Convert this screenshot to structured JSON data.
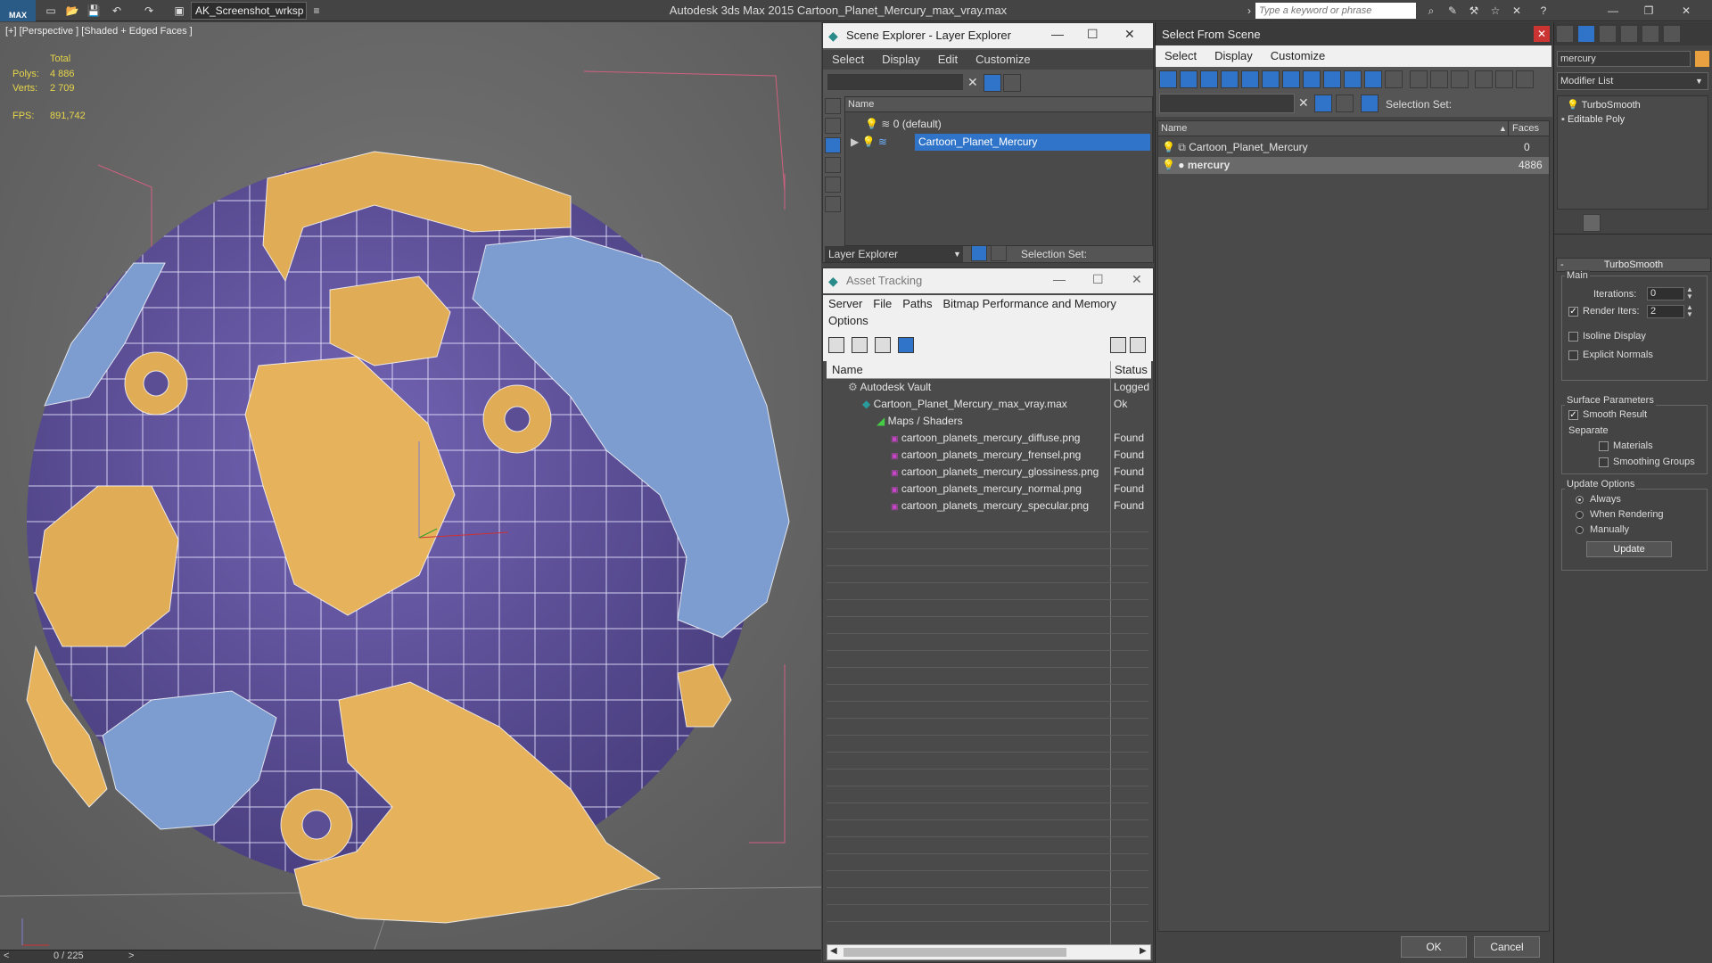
{
  "app": {
    "logo": "MAX",
    "workspace": "AK_Screenshot_wrksp",
    "title": "Autodesk 3ds Max  2015     Cartoon_Planet_Mercury_max_vray.max",
    "search_placeholder": "Type a keyword or phrase"
  },
  "viewport": {
    "label": "[+] [Perspective ] [Shaded + Edged Faces ]",
    "stats": {
      "total_label": "Total",
      "polys_label": "Polys:",
      "polys_value": "4 886",
      "verts_label": "Verts:",
      "verts_value": "2 709",
      "fps_label": "FPS:",
      "fps_value": "891,742"
    },
    "timeline": {
      "frame": "0 / 225",
      "prev": "<",
      "next": ">"
    }
  },
  "scene_explorer": {
    "title": "Scene Explorer - Layer Explorer",
    "menu": [
      "Select",
      "Display",
      "Edit",
      "Customize"
    ],
    "column": "Name",
    "rows": [
      "0 (default)",
      "Cartoon_Planet_Mercury"
    ],
    "footer_dropdown": "Layer Explorer",
    "footer_selection": "Selection Set:"
  },
  "asset_tracking": {
    "title": "Asset Tracking",
    "menu": [
      "Server",
      "File",
      "Paths",
      "Bitmap Performance and Memory",
      "Options"
    ],
    "columns": {
      "name": "Name",
      "status": "Status"
    },
    "rows": [
      {
        "name": "Autodesk Vault",
        "status": "Logged"
      },
      {
        "name": "Cartoon_Planet_Mercury_max_vray.max",
        "status": "Ok"
      },
      {
        "name": "Maps / Shaders",
        "status": ""
      },
      {
        "name": "cartoon_planets_mercury_diffuse.png",
        "status": "Found"
      },
      {
        "name": "cartoon_planets_mercury_frensel.png",
        "status": "Found"
      },
      {
        "name": "cartoon_planets_mercury_glossiness.png",
        "status": "Found"
      },
      {
        "name": "cartoon_planets_mercury_normal.png",
        "status": "Found"
      },
      {
        "name": "cartoon_planets_mercury_specular.png",
        "status": "Found"
      }
    ]
  },
  "select_from_scene": {
    "title": "Select From Scene",
    "menu": [
      "Select",
      "Display",
      "Customize"
    ],
    "selection_set": "Selection Set:",
    "columns": {
      "name": "Name",
      "faces": "Faces"
    },
    "rows": [
      {
        "name": "Cartoon_Planet_Mercury",
        "faces": "0"
      },
      {
        "name": "mercury",
        "faces": "4886"
      }
    ],
    "ok": "OK",
    "cancel": "Cancel"
  },
  "command_panel": {
    "object_name": "mercury",
    "modifier_list": "Modifier List",
    "stack": [
      "TurboSmooth",
      "Editable Poly"
    ],
    "rollout_title": "TurboSmooth",
    "main_label": "Main",
    "iterations_label": "Iterations:",
    "iterations_value": "0",
    "render_iters_label": "Render Iters:",
    "render_iters_value": "2",
    "isoline_label": "Isoline Display",
    "explicit_normals_label": "Explicit Normals",
    "surface_params_label": "Surface Parameters",
    "smooth_result_label": "Smooth Result",
    "separate_label": "Separate",
    "materials_label": "Materials",
    "smoothing_groups_label": "Smoothing Groups",
    "update_options_label": "Update Options",
    "always_label": "Always",
    "when_rendering_label": "When Rendering",
    "manually_label": "Manually",
    "update_button": "Update"
  },
  "colors": {
    "planet_purple": "#6a5ca6",
    "crater_orange": "#e6b25c",
    "crater_blue": "#7d9ccf",
    "selection_blue": "#2f74c9"
  }
}
